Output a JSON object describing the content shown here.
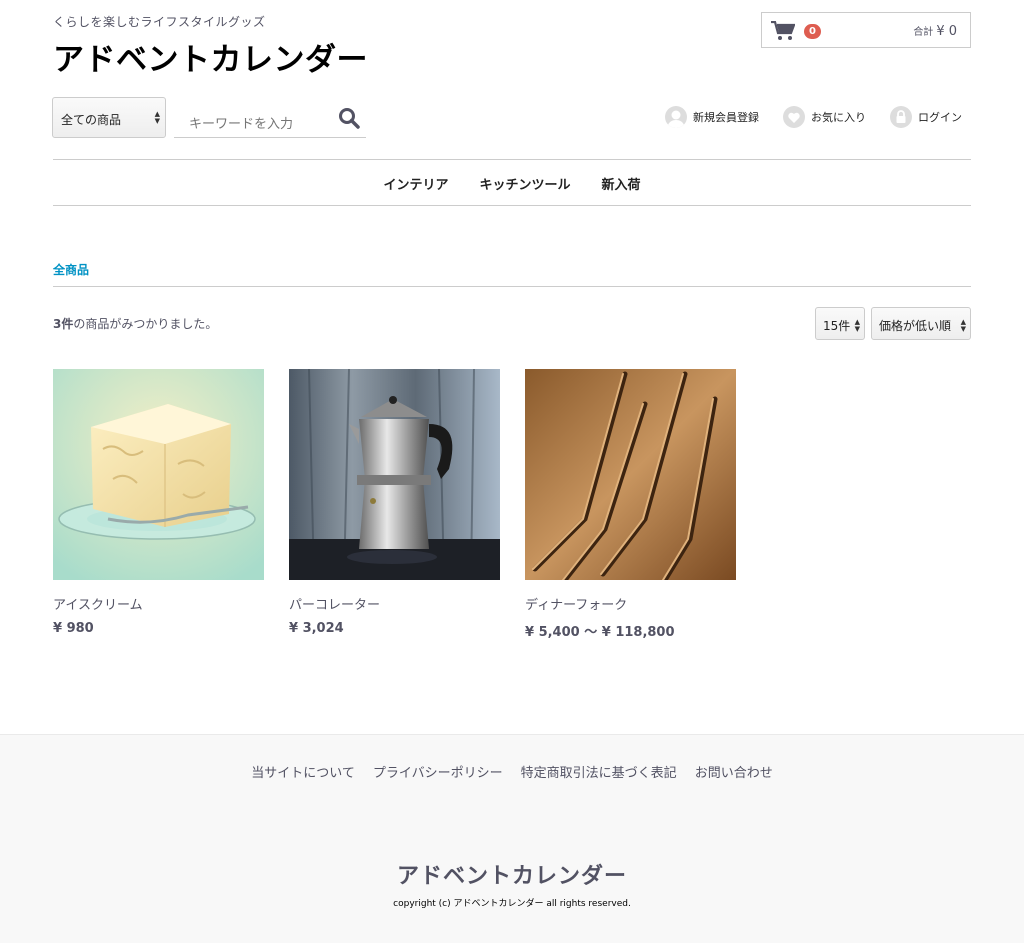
{
  "header": {
    "tagline": "くらしを楽しむライフスタイルグッズ",
    "logo": "アドベントカレンダー"
  },
  "cart": {
    "count": "0",
    "total_label": "合計",
    "total_value": "¥ 0"
  },
  "search": {
    "category_selected": "全ての商品",
    "placeholder": "キーワードを入力"
  },
  "user_nav": {
    "register": "新規会員登録",
    "favorites": "お気に入り",
    "login": "ログイン"
  },
  "gnav": {
    "items": [
      "インテリア",
      "キッチンツール",
      "新入荷"
    ]
  },
  "main": {
    "heading": "全商品",
    "result_count": "3件",
    "result_suffix": "の商品がみつかりました。",
    "disp_count": "15件",
    "sort_order": "価格が低い順"
  },
  "products": [
    {
      "name": "アイスクリーム",
      "price": "¥ 980"
    },
    {
      "name": "パーコレーター",
      "price": "¥ 3,024"
    },
    {
      "name": "ディナーフォーク",
      "price": "¥ 5,400 ～ ¥ 118,800"
    }
  ],
  "footer": {
    "links": [
      "当サイトについて",
      "プライバシーポリシー",
      "特定商取引法に基づく表記",
      "お問い合わせ"
    ],
    "logo": "アドベントカレンダー",
    "copyright": "copyright (c) アドベントカレンダー all rights reserved."
  },
  "colors": {
    "accent": "#0092c4",
    "badge": "#de5d50",
    "text": "#525263",
    "footer_bg": "#f8f8f8"
  },
  "icons": {
    "cart": "cart-icon",
    "search": "search-icon",
    "register": "user-icon",
    "favorites": "heart-icon",
    "login": "lock-icon"
  }
}
